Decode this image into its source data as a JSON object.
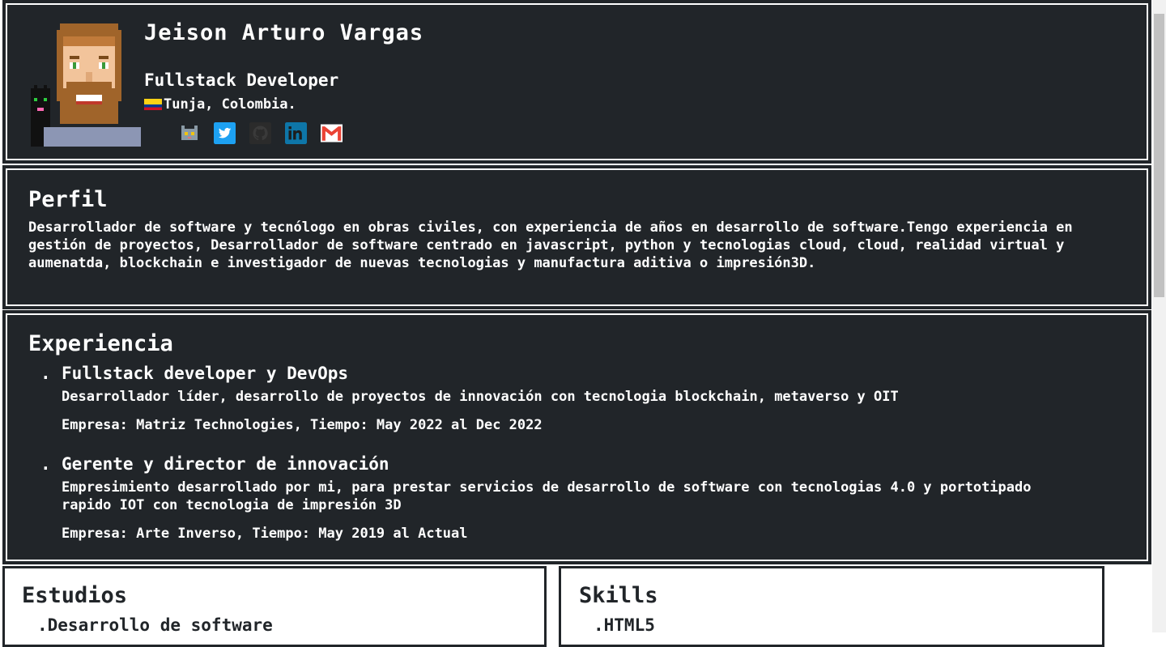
{
  "header": {
    "name": "Jeison Arturo Vargas",
    "role": "Fullstack Developer",
    "location": "Tunja, Colombia.",
    "socials": [
      {
        "icon": "cat-icon",
        "color": "#8a9aa6"
      },
      {
        "icon": "twitter-icon",
        "color": "#1da1f2"
      },
      {
        "icon": "github-icon",
        "color": "#2b2b2b"
      },
      {
        "icon": "linkedin-icon",
        "color": "#0e76a8"
      },
      {
        "icon": "gmail-icon",
        "color": "#ea4335"
      }
    ]
  },
  "perfil": {
    "title": "Perfil",
    "text": "Desarrollador de software y tecnólogo en obras civiles, con experiencia de años en desarrollo de software.Tengo experiencia en gestión de proyectos, Desarrollador de software centrado en javascript, python y tecnologias cloud, cloud, realidad virtual y aumenatda, blockchain e investigador de nuevas tecnologias y manufactura aditiva o impresión3D."
  },
  "experiencia": {
    "title": "Experiencia",
    "jobs": [
      {
        "title": "Fullstack developer y DevOps",
        "desc": "Desarrollador líder, desarrollo de proyectos de innovación con tecnologia blockchain, metaverso y OIT",
        "meta": "Empresa: Matriz Technologies, Tiempo: May 2022 al Dec 2022"
      },
      {
        "title": "Gerente y director de innovación",
        "desc": "Empresimiento desarrollado por mi, para prestar servicios de desarrollo de software con tecnologias 4.0 y portotipado rapido IOT con tecnologia de impresión 3D",
        "meta": "Empresa: Arte Inverso, Tiempo: May 2019 al Actual"
      }
    ]
  },
  "estudios": {
    "title": "Estudios",
    "first_item": ".Desarrollo de software"
  },
  "skills": {
    "title": "Skills",
    "first_item": ".HTML5"
  }
}
